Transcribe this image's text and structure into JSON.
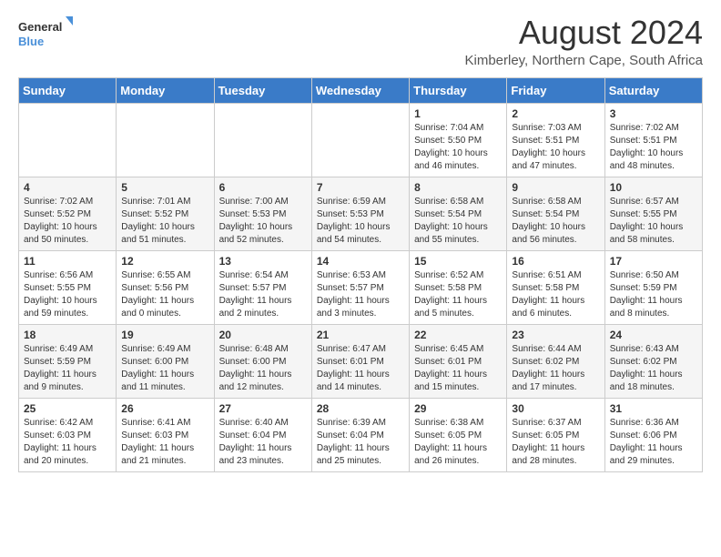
{
  "logo": {
    "line1": "General",
    "line2": "Blue"
  },
  "title": "August 2024",
  "location": "Kimberley, Northern Cape, South Africa",
  "days_of_week": [
    "Sunday",
    "Monday",
    "Tuesday",
    "Wednesday",
    "Thursday",
    "Friday",
    "Saturday"
  ],
  "weeks": [
    [
      {
        "day": "",
        "info": ""
      },
      {
        "day": "",
        "info": ""
      },
      {
        "day": "",
        "info": ""
      },
      {
        "day": "",
        "info": ""
      },
      {
        "day": "1",
        "info": "Sunrise: 7:04 AM\nSunset: 5:50 PM\nDaylight: 10 hours\nand 46 minutes."
      },
      {
        "day": "2",
        "info": "Sunrise: 7:03 AM\nSunset: 5:51 PM\nDaylight: 10 hours\nand 47 minutes."
      },
      {
        "day": "3",
        "info": "Sunrise: 7:02 AM\nSunset: 5:51 PM\nDaylight: 10 hours\nand 48 minutes."
      }
    ],
    [
      {
        "day": "4",
        "info": "Sunrise: 7:02 AM\nSunset: 5:52 PM\nDaylight: 10 hours\nand 50 minutes."
      },
      {
        "day": "5",
        "info": "Sunrise: 7:01 AM\nSunset: 5:52 PM\nDaylight: 10 hours\nand 51 minutes."
      },
      {
        "day": "6",
        "info": "Sunrise: 7:00 AM\nSunset: 5:53 PM\nDaylight: 10 hours\nand 52 minutes."
      },
      {
        "day": "7",
        "info": "Sunrise: 6:59 AM\nSunset: 5:53 PM\nDaylight: 10 hours\nand 54 minutes."
      },
      {
        "day": "8",
        "info": "Sunrise: 6:58 AM\nSunset: 5:54 PM\nDaylight: 10 hours\nand 55 minutes."
      },
      {
        "day": "9",
        "info": "Sunrise: 6:58 AM\nSunset: 5:54 PM\nDaylight: 10 hours\nand 56 minutes."
      },
      {
        "day": "10",
        "info": "Sunrise: 6:57 AM\nSunset: 5:55 PM\nDaylight: 10 hours\nand 58 minutes."
      }
    ],
    [
      {
        "day": "11",
        "info": "Sunrise: 6:56 AM\nSunset: 5:55 PM\nDaylight: 10 hours\nand 59 minutes."
      },
      {
        "day": "12",
        "info": "Sunrise: 6:55 AM\nSunset: 5:56 PM\nDaylight: 11 hours\nand 0 minutes."
      },
      {
        "day": "13",
        "info": "Sunrise: 6:54 AM\nSunset: 5:57 PM\nDaylight: 11 hours\nand 2 minutes."
      },
      {
        "day": "14",
        "info": "Sunrise: 6:53 AM\nSunset: 5:57 PM\nDaylight: 11 hours\nand 3 minutes."
      },
      {
        "day": "15",
        "info": "Sunrise: 6:52 AM\nSunset: 5:58 PM\nDaylight: 11 hours\nand 5 minutes."
      },
      {
        "day": "16",
        "info": "Sunrise: 6:51 AM\nSunset: 5:58 PM\nDaylight: 11 hours\nand 6 minutes."
      },
      {
        "day": "17",
        "info": "Sunrise: 6:50 AM\nSunset: 5:59 PM\nDaylight: 11 hours\nand 8 minutes."
      }
    ],
    [
      {
        "day": "18",
        "info": "Sunrise: 6:49 AM\nSunset: 5:59 PM\nDaylight: 11 hours\nand 9 minutes."
      },
      {
        "day": "19",
        "info": "Sunrise: 6:49 AM\nSunset: 6:00 PM\nDaylight: 11 hours\nand 11 minutes."
      },
      {
        "day": "20",
        "info": "Sunrise: 6:48 AM\nSunset: 6:00 PM\nDaylight: 11 hours\nand 12 minutes."
      },
      {
        "day": "21",
        "info": "Sunrise: 6:47 AM\nSunset: 6:01 PM\nDaylight: 11 hours\nand 14 minutes."
      },
      {
        "day": "22",
        "info": "Sunrise: 6:45 AM\nSunset: 6:01 PM\nDaylight: 11 hours\nand 15 minutes."
      },
      {
        "day": "23",
        "info": "Sunrise: 6:44 AM\nSunset: 6:02 PM\nDaylight: 11 hours\nand 17 minutes."
      },
      {
        "day": "24",
        "info": "Sunrise: 6:43 AM\nSunset: 6:02 PM\nDaylight: 11 hours\nand 18 minutes."
      }
    ],
    [
      {
        "day": "25",
        "info": "Sunrise: 6:42 AM\nSunset: 6:03 PM\nDaylight: 11 hours\nand 20 minutes."
      },
      {
        "day": "26",
        "info": "Sunrise: 6:41 AM\nSunset: 6:03 PM\nDaylight: 11 hours\nand 21 minutes."
      },
      {
        "day": "27",
        "info": "Sunrise: 6:40 AM\nSunset: 6:04 PM\nDaylight: 11 hours\nand 23 minutes."
      },
      {
        "day": "28",
        "info": "Sunrise: 6:39 AM\nSunset: 6:04 PM\nDaylight: 11 hours\nand 25 minutes."
      },
      {
        "day": "29",
        "info": "Sunrise: 6:38 AM\nSunset: 6:05 PM\nDaylight: 11 hours\nand 26 minutes."
      },
      {
        "day": "30",
        "info": "Sunrise: 6:37 AM\nSunset: 6:05 PM\nDaylight: 11 hours\nand 28 minutes."
      },
      {
        "day": "31",
        "info": "Sunrise: 6:36 AM\nSunset: 6:06 PM\nDaylight: 11 hours\nand 29 minutes."
      }
    ]
  ]
}
